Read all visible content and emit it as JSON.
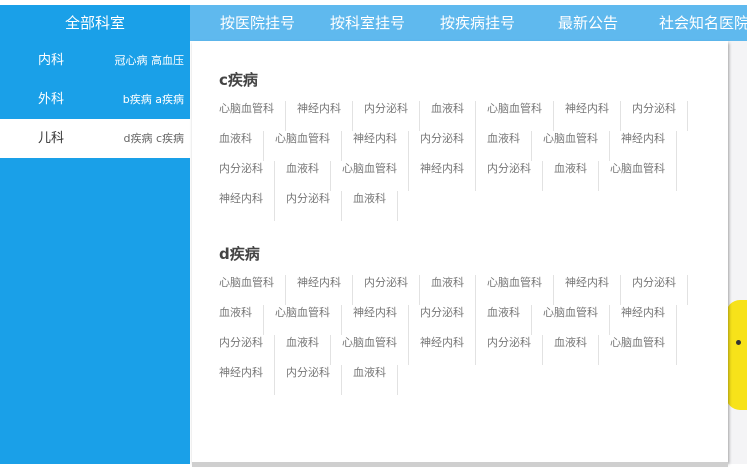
{
  "topnav": {
    "items": [
      "按医院挂号",
      "按科室挂号",
      "按疾病挂号",
      "最新公告",
      "社会知名医院"
    ]
  },
  "sidebar": {
    "title": "全部科室",
    "items": [
      {
        "name": "内科",
        "sub": "冠心病 高血压",
        "active": false
      },
      {
        "name": "外科",
        "sub": "b疾病 a疾病",
        "active": false
      },
      {
        "name": "儿科",
        "sub": "d疾病 c疾病",
        "active": true
      }
    ]
  },
  "panel": {
    "sections": [
      {
        "title": "c疾病",
        "items": [
          "心脑血管科",
          "神经内科",
          "内分泌科",
          "血液科",
          "心脑血管科",
          "神经内科",
          "内分泌科",
          "血液科",
          "心脑血管科",
          "神经内科",
          "内分泌科",
          "血液科",
          "心脑血管科",
          "神经内科",
          "内分泌科",
          "血液科",
          "心脑血管科",
          "神经内科",
          "内分泌科",
          "血液科",
          "心脑血管科",
          "神经内科",
          "内分泌科",
          "血液科"
        ]
      },
      {
        "title": "d疾病",
        "items": [
          "心脑血管科",
          "神经内科",
          "内分泌科",
          "血液科",
          "心脑血管科",
          "神经内科",
          "内分泌科",
          "血液科",
          "心脑血管科",
          "神经内科",
          "内分泌科",
          "血液科",
          "心脑血管科",
          "神经内科",
          "内分泌科",
          "血液科",
          "心脑血管科",
          "神经内科",
          "内分泌科",
          "血液科",
          "心脑血管科",
          "神经内科",
          "内分泌科",
          "血液科"
        ]
      }
    ]
  },
  "colors": {
    "sidebar": "#1aa0e8",
    "topnav": "#5fb9ee",
    "panel": "#ffffff"
  }
}
